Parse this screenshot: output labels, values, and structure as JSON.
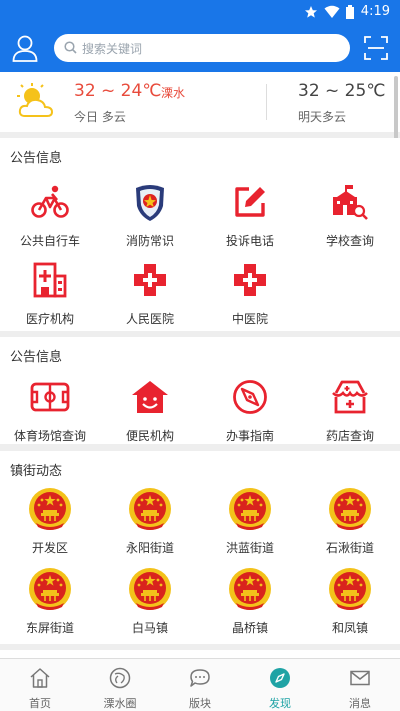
{
  "status_bar": {
    "time": "4:19"
  },
  "header": {
    "search_placeholder": "搜索关键词"
  },
  "weather": {
    "today_temp": "32 ~ 24℃",
    "city": "溧水",
    "today_label": "今日 多云",
    "tomorrow_temp": "32 ~ 25℃",
    "tomorrow_label": "明天多云"
  },
  "sections": [
    {
      "title": "公告信息",
      "items": [
        {
          "label": "公共自行车",
          "icon": "bicycle-icon"
        },
        {
          "label": "消防常识",
          "icon": "fire-police-badge-icon"
        },
        {
          "label": "投诉电话",
          "icon": "edit-icon"
        },
        {
          "label": "学校查询",
          "icon": "school-search-icon"
        },
        {
          "label": "医疗机构",
          "icon": "hospital-building-icon"
        },
        {
          "label": "人民医院",
          "icon": "medical-cross-icon"
        },
        {
          "label": "中医院",
          "icon": "medical-cross-icon"
        }
      ]
    },
    {
      "title": "公告信息",
      "items": [
        {
          "label": "体育场馆查询",
          "icon": "stadium-icon"
        },
        {
          "label": "便民机构",
          "icon": "smile-house-icon"
        },
        {
          "label": "办事指南",
          "icon": "compass-icon"
        },
        {
          "label": "药店查询",
          "icon": "pharmacy-icon"
        }
      ]
    },
    {
      "title": "镇街动态",
      "items": [
        {
          "label": "开发区",
          "icon": "national-emblem-icon"
        },
        {
          "label": "永阳街道",
          "icon": "national-emblem-icon"
        },
        {
          "label": "洪蓝街道",
          "icon": "national-emblem-icon"
        },
        {
          "label": "石湫街道",
          "icon": "national-emblem-icon"
        },
        {
          "label": "东屏街道",
          "icon": "national-emblem-icon"
        },
        {
          "label": "白马镇",
          "icon": "national-emblem-icon"
        },
        {
          "label": "晶桥镇",
          "icon": "national-emblem-icon"
        },
        {
          "label": "和凤镇",
          "icon": "national-emblem-icon"
        }
      ]
    }
  ],
  "tabbar": {
    "tabs": [
      {
        "label": "首页",
        "icon": "home-icon"
      },
      {
        "label": "溧水圈",
        "icon": "circle-icon"
      },
      {
        "label": "版块",
        "icon": "chat-bubble-icon"
      },
      {
        "label": "发现",
        "icon": "discover-compass-icon",
        "active": true
      },
      {
        "label": "消息",
        "icon": "mail-icon"
      }
    ]
  },
  "colors": {
    "brand_blue": "#1976e8",
    "icon_red": "#e8232f",
    "active_teal": "#1fa3a5",
    "temp_red": "#e84b3c"
  }
}
